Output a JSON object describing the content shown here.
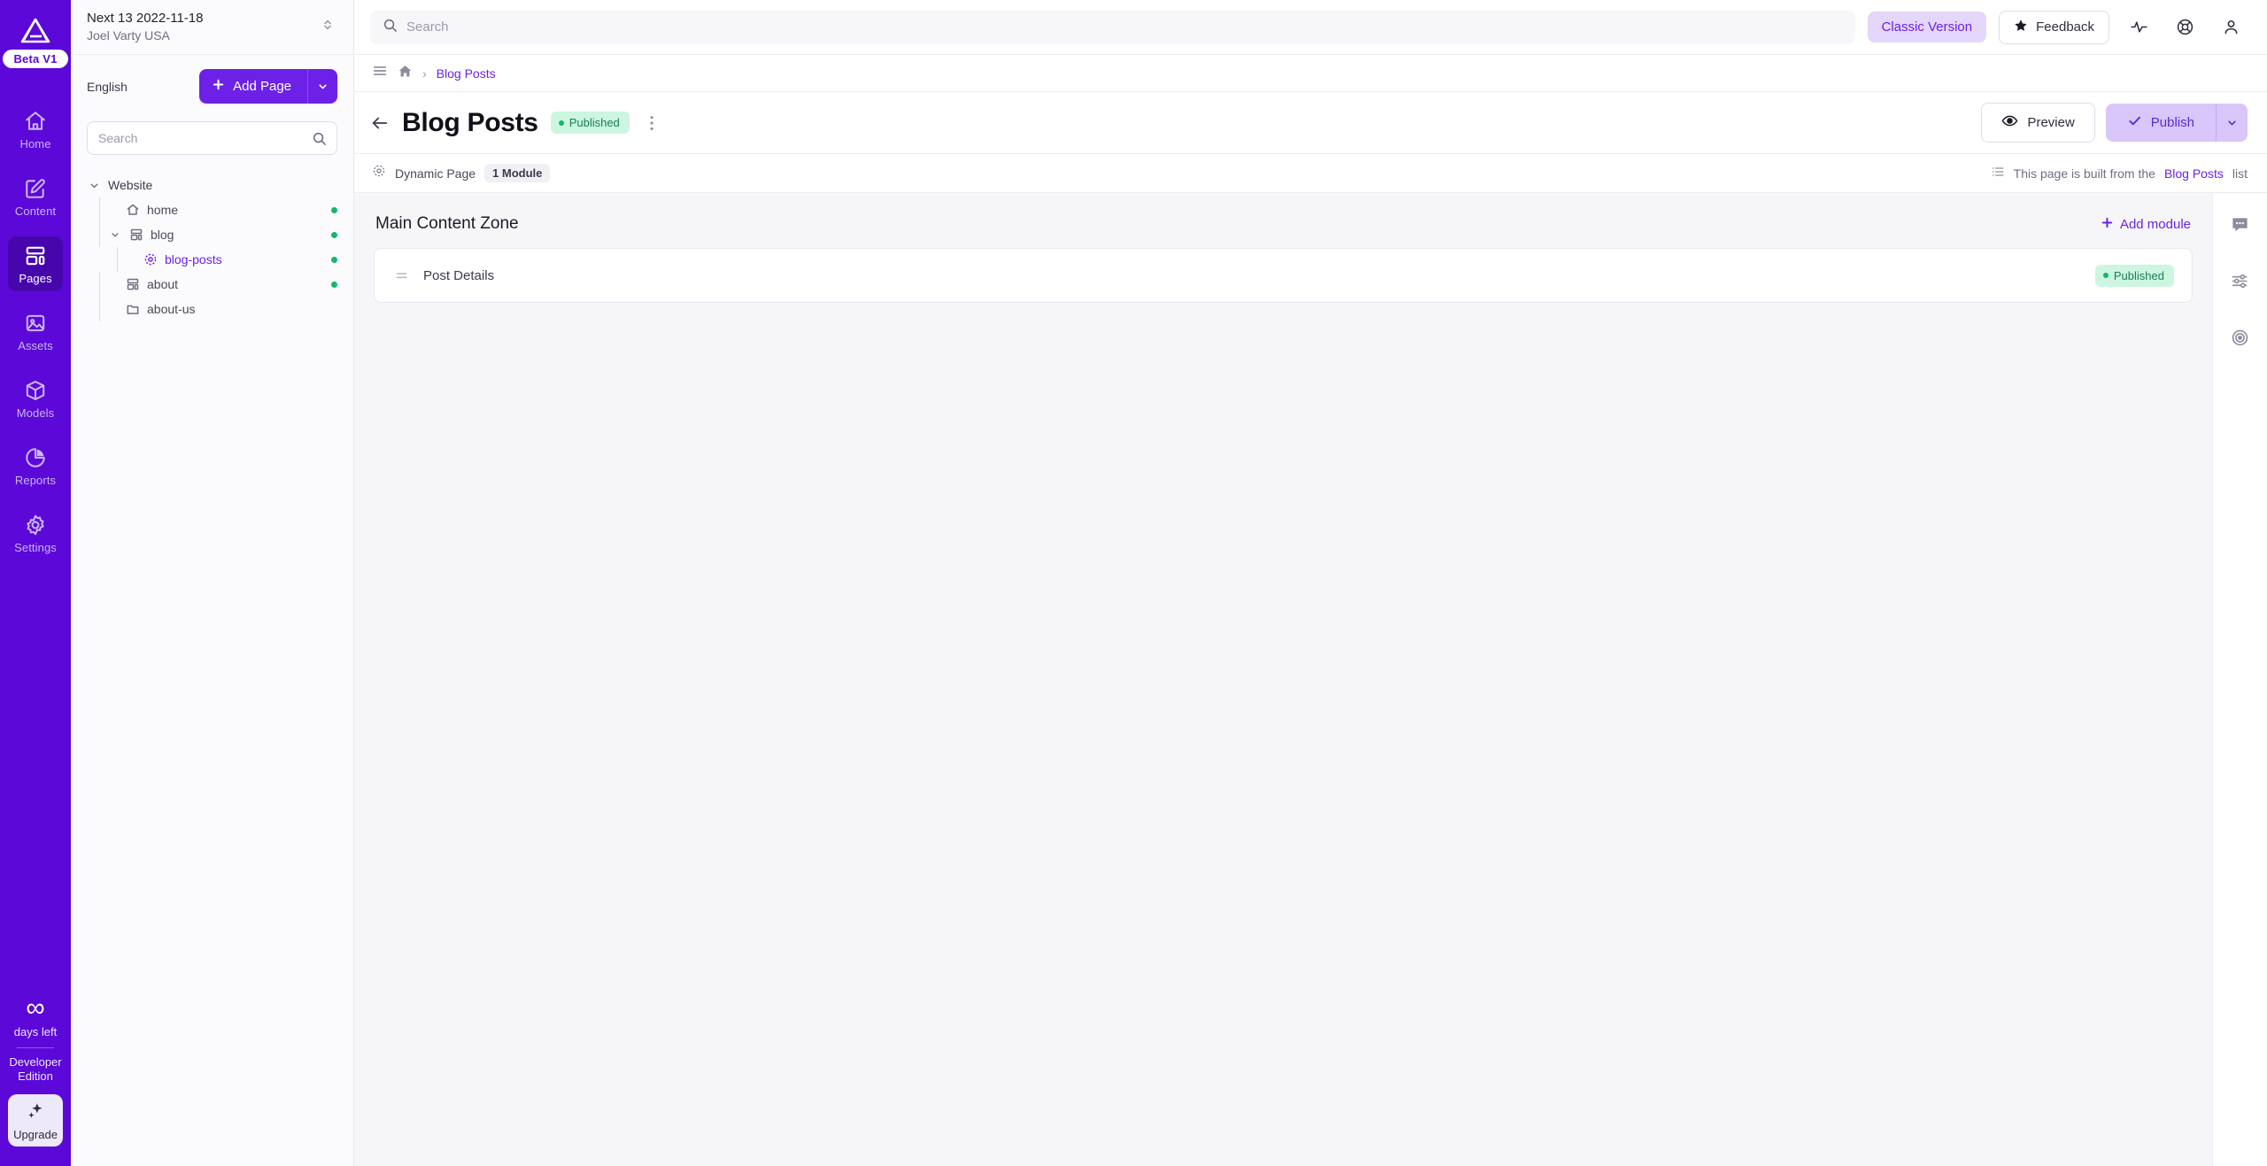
{
  "brand": {
    "logo_icon": "triangle-logo-icon",
    "beta_badge": "Beta V1"
  },
  "rail": {
    "items": [
      {
        "label": "Home",
        "icon": "home-icon",
        "active": false
      },
      {
        "label": "Content",
        "icon": "edit-square-icon",
        "active": false
      },
      {
        "label": "Pages",
        "icon": "pages-layout-icon",
        "active": true
      },
      {
        "label": "Assets",
        "icon": "image-icon",
        "active": false
      },
      {
        "label": "Models",
        "icon": "cube-icon",
        "active": false
      },
      {
        "label": "Reports",
        "icon": "pie-chart-icon",
        "active": false
      },
      {
        "label": "Settings",
        "icon": "gear-icon",
        "active": false
      }
    ],
    "trial": {
      "infinity_glyph": "∞",
      "days_left": "days left",
      "edition_line1": "Developer",
      "edition_line2": "Edition"
    },
    "upgrade": {
      "label": "Upgrade",
      "icon": "sparkle-icon"
    }
  },
  "pages_panel": {
    "site_name": "Next 13 2022-11-18",
    "site_owner": "Joel Varty USA",
    "switcher_icon": "chevron-up-down-icon",
    "language": "English",
    "add_page_label": "Add Page",
    "add_page_caret_icon": "chevron-down-icon",
    "search": {
      "placeholder": "Search",
      "value": "",
      "icon": "search-icon"
    },
    "tree": {
      "root_label": "Website",
      "root_caret_icon": "chevron-down-icon",
      "nodes": [
        {
          "label": "home",
          "icon": "home-icon",
          "indent": 2,
          "status_dot": true,
          "selected": false,
          "caret": false
        },
        {
          "label": "blog",
          "icon": "pages-layout-icon",
          "indent": 1,
          "status_dot": true,
          "selected": false,
          "caret": true
        },
        {
          "label": "blog-posts",
          "icon": "dynamic-page-icon",
          "indent": 3,
          "status_dot": true,
          "selected": true,
          "caret": false
        },
        {
          "label": "about",
          "icon": "pages-layout-icon",
          "indent": 2,
          "status_dot": true,
          "selected": false,
          "caret": false
        },
        {
          "label": "about-us",
          "icon": "folder-icon",
          "indent": 2,
          "status_dot": false,
          "selected": false,
          "caret": false
        }
      ]
    }
  },
  "topbar": {
    "search": {
      "placeholder": "Search",
      "value": "",
      "icon": "search-icon"
    },
    "classic_version_label": "Classic Version",
    "feedback_label": "Feedback",
    "feedback_icon": "star-icon",
    "activity_icon": "activity-pulse-icon",
    "help_icon": "lifebuoy-icon",
    "account_icon": "user-icon"
  },
  "breadcrumb": {
    "menu_icon": "hamburger-menu-icon",
    "home_icon": "home-filled-icon",
    "separator": "›",
    "current": "Blog Posts"
  },
  "page_header": {
    "back_icon": "arrow-left-icon",
    "title": "Blog Posts",
    "status": "Published",
    "kebab_icon": "more-vertical-icon",
    "preview_label": "Preview",
    "preview_icon": "eye-icon",
    "publish_label": "Publish",
    "publish_icon": "check-icon",
    "publish_caret_icon": "chevron-down-icon"
  },
  "meta_bar": {
    "type_icon": "dynamic-page-icon",
    "type_label": "Dynamic Page",
    "module_count": "1 Module",
    "source_icon": "list-icon",
    "source_prefix": "This page is built from the",
    "source_link": "Blog Posts",
    "source_suffix": "list"
  },
  "canvas": {
    "zone_title": "Main Content Zone",
    "add_module_label": "Add module",
    "add_module_icon": "plus-icon",
    "modules": [
      {
        "name": "Post Details",
        "status": "Published",
        "drag_icon": "drag-handle-icon"
      }
    ]
  },
  "right_rail": {
    "items": [
      {
        "icon": "comment-bubble-icon",
        "name": "comments-panel"
      },
      {
        "icon": "sliders-icon",
        "name": "settings-panel"
      },
      {
        "icon": "target-icon",
        "name": "personalization-panel"
      }
    ]
  },
  "colors": {
    "brand_purple": "#5b08d8",
    "accent_purple": "#6d21e6",
    "published_green": "#12b76a",
    "published_bg": "#ccf6e0",
    "canvas_bg": "#f6f6f9"
  }
}
